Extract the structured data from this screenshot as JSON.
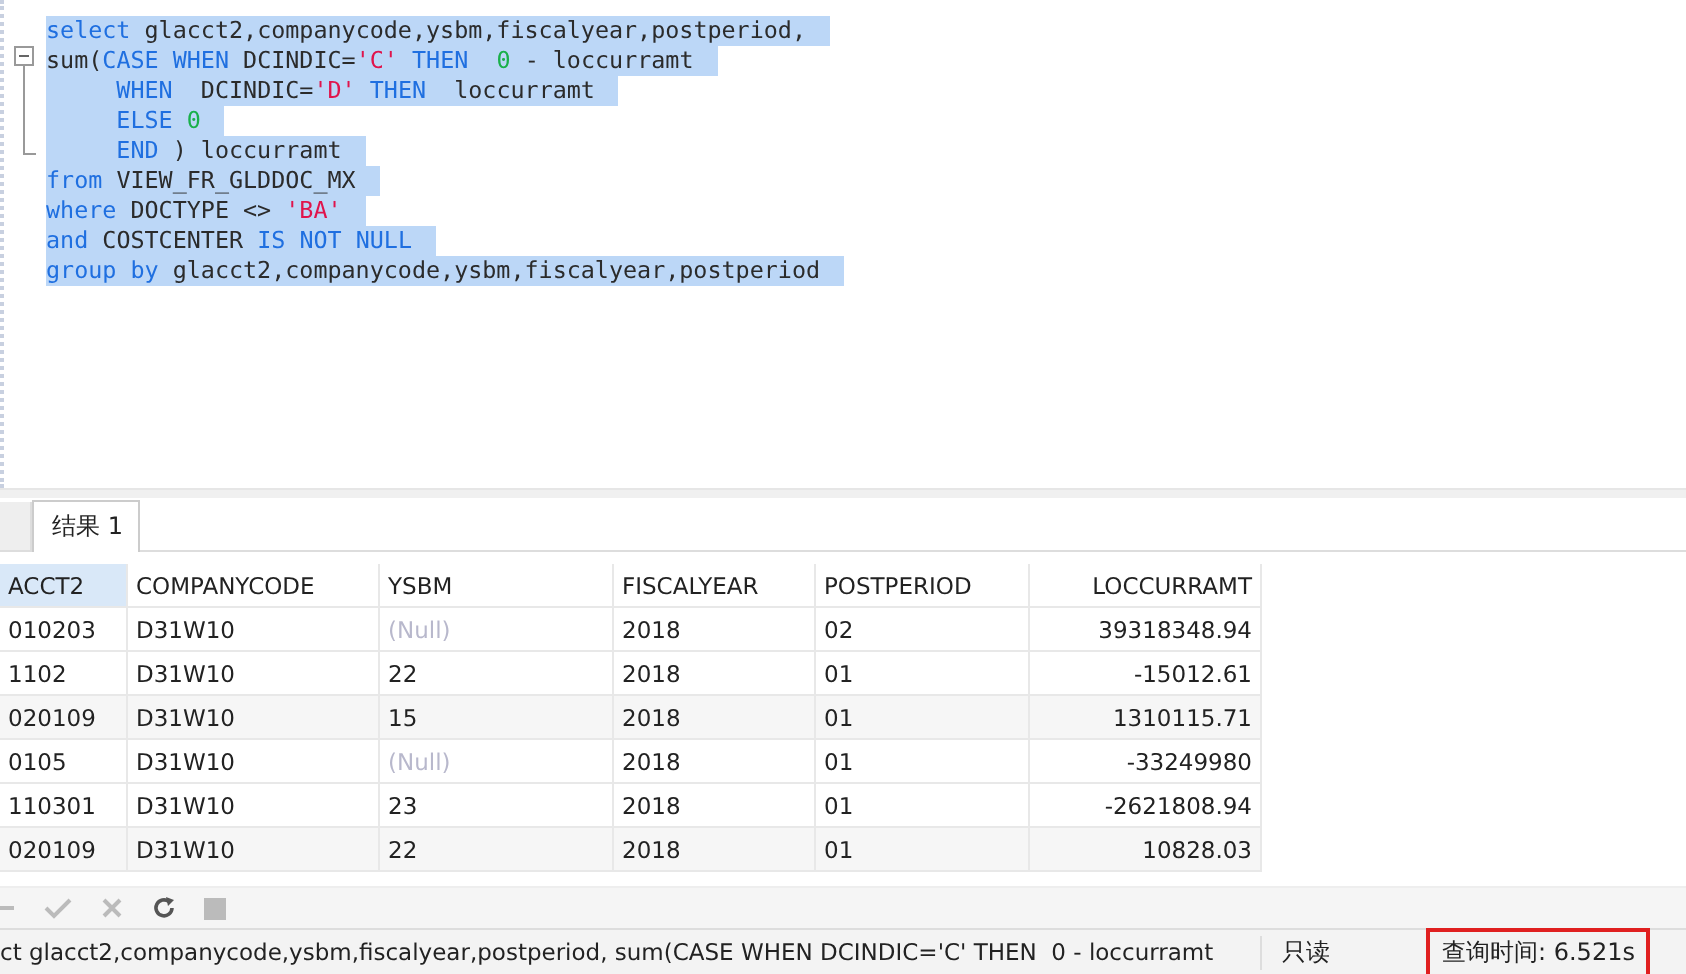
{
  "editor": {
    "lines": [
      [
        {
          "t": "select",
          "kind": "kw"
        },
        {
          "t": " glacct2,companycode,ysbm,fiscalyear,postperiod,",
          "kind": "id"
        }
      ],
      [
        {
          "t": "sum(",
          "kind": "id"
        },
        {
          "t": "CASE WHEN",
          "kind": "kw"
        },
        {
          "t": " DCINDIC=",
          "kind": "id"
        },
        {
          "t": "'C'",
          "kind": "str"
        },
        {
          "t": " THEN",
          "kind": "kw"
        },
        {
          "t": "  0",
          "kind": "num"
        },
        {
          "t": " - loccurramt",
          "kind": "id"
        }
      ],
      [
        {
          "t": "     WHEN",
          "kind": "kw"
        },
        {
          "t": "  DCINDIC=",
          "kind": "id"
        },
        {
          "t": "'D'",
          "kind": "str"
        },
        {
          "t": " THEN",
          "kind": "kw"
        },
        {
          "t": "  loccurramt",
          "kind": "id"
        }
      ],
      [
        {
          "t": "     ELSE",
          "kind": "kw"
        },
        {
          "t": " 0",
          "kind": "num"
        }
      ],
      [
        {
          "t": "     END",
          "kind": "kw"
        },
        {
          "t": " ) loccurramt",
          "kind": "id"
        }
      ],
      [
        {
          "t": "from",
          "kind": "kw"
        },
        {
          "t": " VIEW_FR_GLDDOC_MX",
          "kind": "id"
        }
      ],
      [
        {
          "t": "where",
          "kind": "kw"
        },
        {
          "t": " DOCTYPE <> ",
          "kind": "id"
        },
        {
          "t": "'BA'",
          "kind": "str"
        }
      ],
      [
        {
          "t": "and",
          "kind": "kw"
        },
        {
          "t": " COSTCENTER ",
          "kind": "id"
        },
        {
          "t": "IS NOT NULL",
          "kind": "kw"
        }
      ],
      [
        {
          "t": "group by",
          "kind": "kw"
        },
        {
          "t": " glacct2,companycode,ysbm,fiscalyear,postperiod",
          "kind": "id"
        }
      ]
    ],
    "selected": true
  },
  "tabs": [
    {
      "label": "结果 1",
      "selected": true
    }
  ],
  "table": {
    "columns": [
      {
        "label": "ACCT2",
        "kind": "text"
      },
      {
        "label": "COMPANYCODE",
        "kind": "text"
      },
      {
        "label": "YSBM",
        "kind": "text"
      },
      {
        "label": "FISCALYEAR",
        "kind": "text"
      },
      {
        "label": "POSTPERIOD",
        "kind": "text"
      },
      {
        "label": "LOCCURRAMT",
        "kind": "number"
      }
    ],
    "rows": [
      {
        "cells": [
          "010203",
          "D31W10",
          "(Null)",
          "2018",
          "02",
          "39318348.94"
        ],
        "ysbm_null": true
      },
      {
        "cells": [
          "1102",
          "D31W10",
          "22",
          "2018",
          "01",
          "-15012.61"
        ],
        "ysbm_null": false
      },
      {
        "cells": [
          "020109",
          "D31W10",
          "15",
          "2018",
          "01",
          "1310115.71"
        ],
        "ysbm_null": false
      },
      {
        "cells": [
          "0105",
          "D31W10",
          "(Null)",
          "2018",
          "01",
          "-33249980"
        ],
        "ysbm_null": true
      },
      {
        "cells": [
          "110301",
          "D31W10",
          "23",
          "2018",
          "01",
          "-2621808.94"
        ],
        "ysbm_null": false
      },
      {
        "cells": [
          "020109",
          "D31W10",
          "22",
          "2018",
          "01",
          "10828.03"
        ],
        "ysbm_null": false
      }
    ]
  },
  "status_bar": {
    "sql": "ct glacct2,companycode,ysbm,fiscalyear,postperiod, sum(CASE WHEN DCINDIC='C' THEN  0 - loccurramt",
    "mode": "只读",
    "query_time": "查询时间: 6.521s",
    "query_time_highlighted": true
  }
}
